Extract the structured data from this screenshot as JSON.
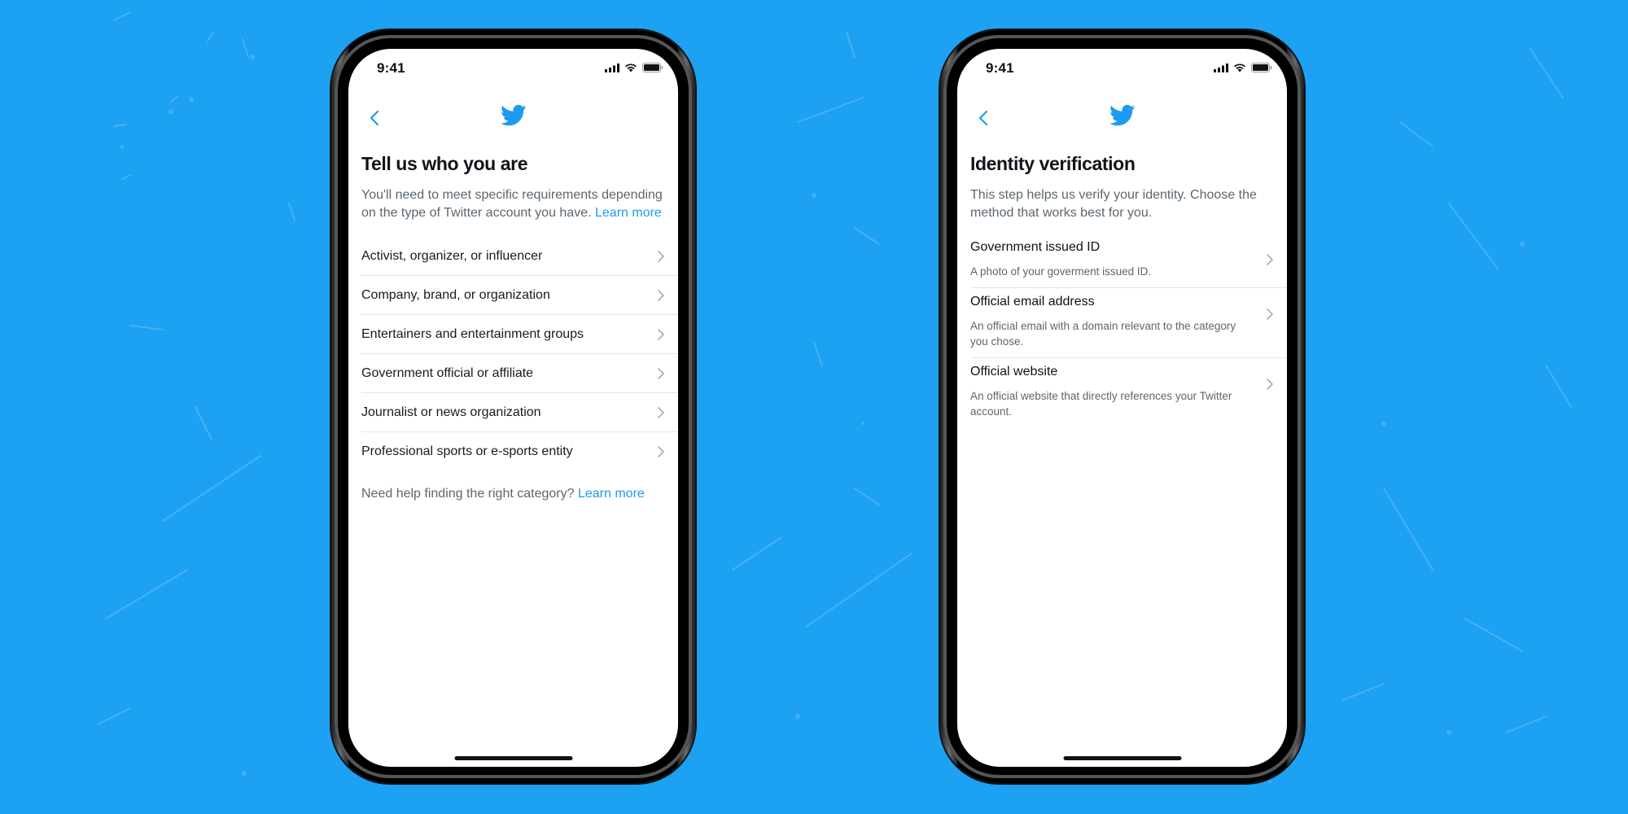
{
  "theme": {
    "background": "#1da1f2",
    "accent": "#1d9bf0",
    "text_primary": "#0f1419",
    "text_secondary": "#5b6770"
  },
  "left_phone": {
    "status_bar": {
      "time": "9:41",
      "icons": [
        "cellular-signal-icon",
        "wifi-icon",
        "battery-icon"
      ]
    },
    "nav": {
      "back_icon": "chevron-left-icon",
      "logo_icon": "twitter-bird-icon"
    },
    "title": "Tell us who you are",
    "description": "You'll need to meet specific requirements depending on the type of Twitter account you have.",
    "description_link": "Learn more",
    "categories": [
      {
        "label": "Activist, organizer, or influencer"
      },
      {
        "label": "Company, brand, or organization"
      },
      {
        "label": "Entertainers and entertainment groups"
      },
      {
        "label": "Government official or affiliate"
      },
      {
        "label": "Journalist or news organization"
      },
      {
        "label": "Professional sports or e-sports entity"
      }
    ],
    "help_text": "Need help finding the right category?",
    "help_link": "Learn more"
  },
  "right_phone": {
    "status_bar": {
      "time": "9:41",
      "icons": [
        "cellular-signal-icon",
        "wifi-icon",
        "battery-icon"
      ]
    },
    "nav": {
      "back_icon": "chevron-left-icon",
      "logo_icon": "twitter-bird-icon"
    },
    "title": "Identity verification",
    "description": "This step helps us verify your identity. Choose the method that works best for you.",
    "methods": [
      {
        "title": "Government issued ID",
        "description": "A photo of your goverment issued ID."
      },
      {
        "title": "Official email address",
        "description": "An official email with a domain relevant to the category you chose."
      },
      {
        "title": "Official website",
        "description": "An official website that directly references your Twitter account."
      }
    ]
  }
}
